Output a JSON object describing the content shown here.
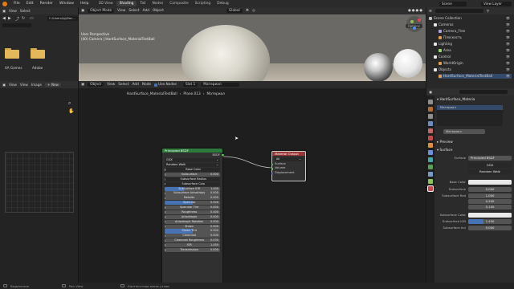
{
  "topbar": {
    "menus": [
      "File",
      "Edit",
      "Render",
      "Window",
      "Help"
    ],
    "workspaces": [
      "3D View",
      "Shading",
      "Tail",
      "Nodes",
      "Composite",
      "Scripting",
      "Debug"
    ],
    "active_workspace": "Shading",
    "scene": "Scene",
    "view_layer": "View Layer"
  },
  "filebrowser": {
    "menus": [
      "View",
      "Select"
    ],
    "path": "C:\\Users\\Ig\\Doc...",
    "folders": [
      {
        "label": "4A Games"
      },
      {
        "label": "Adobe"
      }
    ]
  },
  "imageeditor": {
    "menus": [
      "View",
      "View",
      "Image"
    ],
    "new_button": "New"
  },
  "viewport": {
    "mode": "Object Mode",
    "menus": [
      "View",
      "Select",
      "Add",
      "Object"
    ],
    "orientation": "Global",
    "options": "Options",
    "info_line1": "User Perspective",
    "info_line2": "(40) Camera | HardSurface_MaterialTestBall"
  },
  "nodeeditor": {
    "menus": [
      "Object",
      "View",
      "Select",
      "Add",
      "Node"
    ],
    "use_nodes": "Use Nodes",
    "slot": "Slot 1",
    "material": "Материал",
    "breadcrumb": [
      "HardSurface_MaterialTestBall",
      "Plane.013",
      "Материал"
    ],
    "bsdf_node": {
      "title": "Principled BSDF",
      "output": "BSDF",
      "distribution": "GGX",
      "subsurface_method": "Random Walk",
      "rows": [
        {
          "label": "Base Color",
          "value": "",
          "fill": 0
        },
        {
          "label": "Subsurface",
          "value": "0.000",
          "fill": 0
        },
        {
          "label": "Subsurface Radius",
          "value": "",
          "fill": 0
        },
        {
          "label": "Subsurface Colo",
          "value": "",
          "fill": 0
        },
        {
          "label": "Subsurface IOR",
          "value": "1.400",
          "fill": 0.35
        },
        {
          "label": "Subsurface Anisotropy",
          "value": "0.000",
          "fill": 0
        },
        {
          "label": "Metallic",
          "value": "0.000",
          "fill": 0
        },
        {
          "label": "Specular",
          "value": "0.500",
          "fill": 0.5
        },
        {
          "label": "Specular Tint",
          "value": "0.000",
          "fill": 0
        },
        {
          "label": "Roughness",
          "value": "0.400",
          "fill": 0
        },
        {
          "label": "Anisotropic",
          "value": "0.000",
          "fill": 0
        },
        {
          "label": "Anisotropic Rotation",
          "value": "0.000",
          "fill": 0
        },
        {
          "label": "Sheen",
          "value": "0.000",
          "fill": 0
        },
        {
          "label": "Sheen Tint",
          "value": "0.500",
          "fill": 0.5
        },
        {
          "label": "Clearcoat",
          "value": "0.000",
          "fill": 0
        },
        {
          "label": "Clearcoat Roughness",
          "value": "0.030",
          "fill": 0
        },
        {
          "label": "IOR",
          "value": "1.450",
          "fill": 0
        },
        {
          "label": "Transmission",
          "value": "0.000",
          "fill": 0
        }
      ]
    },
    "output_node": {
      "title": "Material Output",
      "target": "All",
      "inputs": [
        "Surface",
        "Volume",
        "Displacement"
      ]
    }
  },
  "outliner": {
    "title": "Scene Collection",
    "items": [
      {
        "label": "Scene Collection",
        "color": "#bfbfbf"
      },
      {
        "label": "Cameras",
        "color": "#e5e5e5"
      },
      {
        "label": "Camera_Free",
        "color": "#b5a0e0"
      },
      {
        "label": "Плоскость",
        "color": "#e59a4c"
      },
      {
        "label": "Lighting",
        "color": "#e5e5e5"
      },
      {
        "label": "Area",
        "color": "#9bd76e"
      },
      {
        "label": "Control",
        "color": "#e5e5e5"
      },
      {
        "label": "WorldOrigin",
        "color": "#e59a4c"
      },
      {
        "label": "Objects",
        "color": "#e5e5e5"
      },
      {
        "label": "HardSurface_MaterialTestBall",
        "color": "#e59a4c"
      }
    ]
  },
  "properties": {
    "object": "HardSurface_Materia",
    "material_slot": "Материал",
    "material_name": "Материал",
    "preview": "Preview",
    "surface_section": "Surface",
    "surface_label": "Surface",
    "surface_value": "Principled BSDF",
    "distribution": "GGX",
    "subsurface_method": "Random Walk",
    "fields": [
      {
        "label": "Base Color",
        "value": ""
      },
      {
        "label": "Subsurface",
        "value": "0.000"
      },
      {
        "label": "Subsurface Rad",
        "value": "1.000"
      },
      {
        "label": "",
        "value": "0.200"
      },
      {
        "label": "",
        "value": "0.100"
      },
      {
        "label": "Subsurface Color",
        "value": ""
      },
      {
        "label": "Subsurface IOR",
        "value": "1.400"
      },
      {
        "label": "Subsurface Ani",
        "value": "0.000"
      }
    ]
  },
  "statusbar": {
    "left": "Выделение",
    "middle": "Pan View",
    "right": "Контекстное меню узлов"
  }
}
